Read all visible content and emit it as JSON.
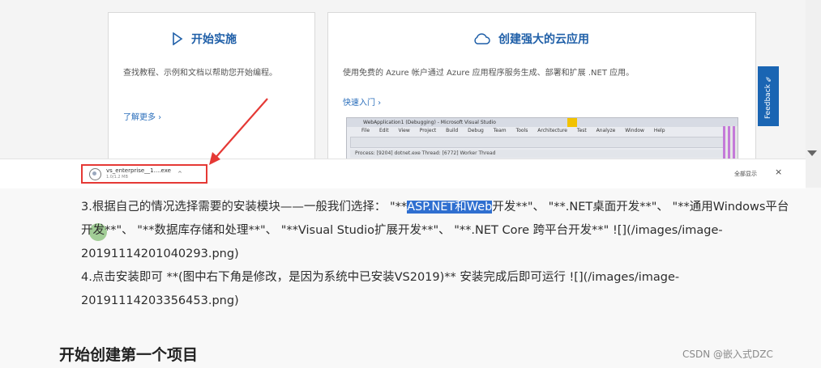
{
  "cards": [
    {
      "title": "开始实施",
      "icon": "play-icon",
      "text": "查找教程、示例和文档以帮助您开始编程。",
      "link": "了解更多 ›"
    },
    {
      "title": "创建强大的云应用",
      "icon": "cloud-icon",
      "text": "使用免费的 Azure 帐户通过 Azure 应用程序服务生成、部署和扩展 .NET 应用。",
      "link": "快速入门 ›"
    }
  ],
  "vs_window": {
    "title": "WebApplication1 (Debugging) - Microsoft Visual Studio",
    "menu": [
      "File",
      "Edit",
      "View",
      "Project",
      "Build",
      "Debug",
      "Team",
      "Tools",
      "Architecture",
      "Test",
      "Analyze",
      "Window",
      "Help"
    ],
    "process_bar": "Process: [9204] dotnet.exe   Thread: [6772] Worker Thread"
  },
  "feedback_label": "Feedback ✎",
  "download": {
    "filename": "vs_enterprise__1....exe",
    "size": "1.0/1.2 MB",
    "show_all": "全部显示",
    "close": "×"
  },
  "content": {
    "step3_prefix": "3.根据自己的情况选择需要的安装模块——一般我们选择：  \"**",
    "step3_highlight": "ASP.NET和Web",
    "step3_rest": "开发**\"、 \"**.NET桌面开发**\"、 \"**通用Windows平台开发**\"、 \"**数据库存储和处理**\"、 \"**Visual Studio扩展开发**\"、 \"**.NET Core 跨平台开发**\" ![](/images/image-20191114201040293.png)",
    "step4": "4.点击安装即可 **(图中右下角是修改，是因为系统中已安装VS2019)** 安装完成后即可运行 ![](/images/image-20191114203356453.png)",
    "heading": "开始创建第一个项目"
  },
  "watermark": "CSDN @嵌入式DZC",
  "colors": {
    "accent": "#1f5fa8",
    "highlight": "#2f6fd0",
    "annotation": "#e53935"
  }
}
